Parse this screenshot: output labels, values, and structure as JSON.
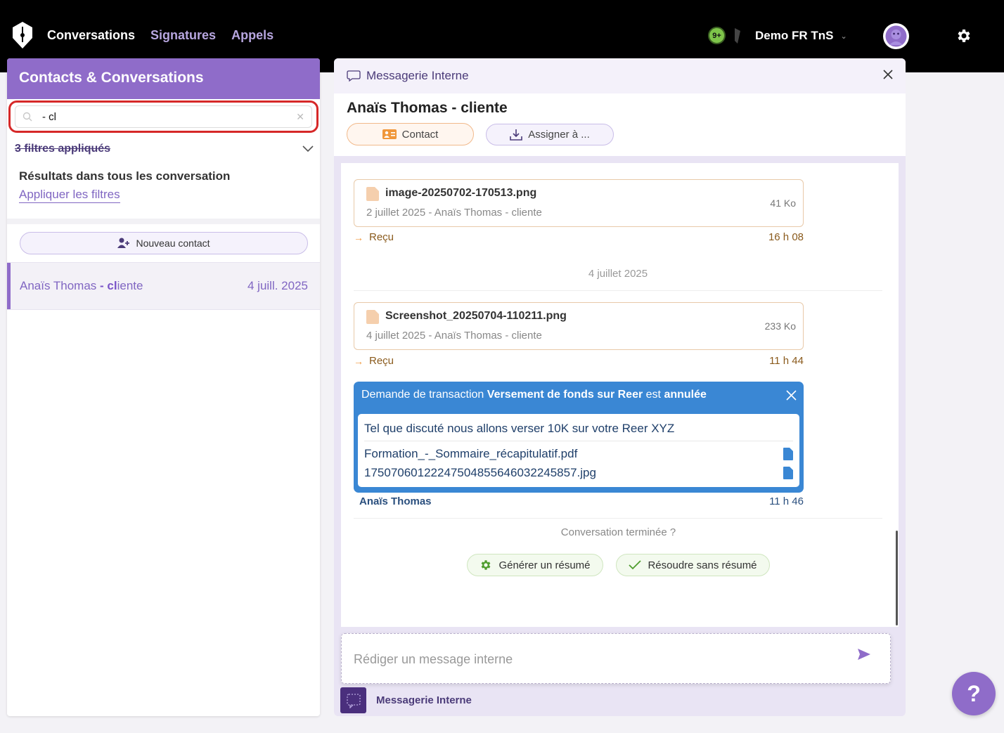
{
  "nav": {
    "items": [
      {
        "label": "Conversations",
        "active": true
      },
      {
        "label": "Signatures",
        "active": false
      },
      {
        "label": "Appels",
        "active": false
      }
    ],
    "notif_count": "9+",
    "account_name": "Demo FR TnS",
    "colors": {
      "bar": "#000000",
      "active": "#ffffff",
      "inactive": "#b7a6df",
      "notif": "#7ec44a"
    }
  },
  "left": {
    "title": "Contacts & Conversations",
    "search_value": "- cl",
    "filters_label": "3 filtres appliqués",
    "results_title": "Résultats dans tous les conversation",
    "apply_filters": "Appliquer les filtres",
    "new_contact": "Nouveau contact",
    "conversations": [
      {
        "name_prefix": "Anaïs Thomas ",
        "name_match": "- cl",
        "name_suffix": "iente",
        "date": "4 juill. 2025"
      }
    ]
  },
  "main": {
    "top_title": "Messagerie Interne",
    "contact_name": "Anaïs Thomas - cliente",
    "contact_button": "Contact",
    "assign_button": "Assigner à ...",
    "files": [
      {
        "name": "image-20250702-170513.png",
        "meta": "2 juillet 2025 - Anaïs Thomas - cliente",
        "size": "41 Ko",
        "status": "Reçu",
        "time": "16 h 08"
      },
      {
        "name": "Screenshot_20250704-110211.png",
        "meta": "4 juillet 2025 - Anaïs Thomas - cliente",
        "size": "233 Ko",
        "status": "Reçu",
        "time": "11 h 44"
      }
    ],
    "date_separator": "4 juillet 2025",
    "transaction": {
      "prefix": "Demande de transaction ",
      "name": "Versement de fonds sur Reer",
      "middle": " est ",
      "state": "annulée",
      "message": "Tel que discuté nous allons verser 10K sur votre Reer XYZ",
      "attachments": [
        "Formation_-_Sommaire_récapitulatif.pdf",
        "1750706012224750485564603224585​7.jpg"
      ],
      "author": "Anaïs Thomas",
      "time": "11 h 46"
    },
    "ended_question": "Conversation terminée ?",
    "generate_summary": "Générer un résumé",
    "resolve_no_summary": "Résoudre sans résumé",
    "composer_placeholder": "Rédiger un message interne",
    "footer_label": "Messagerie Interne",
    "colors": {
      "accent": "#8f6cc9",
      "transaction": "#3a87d4",
      "file_border": "#e8c9a9",
      "pill_green": "#f3faee"
    }
  },
  "help_label": "?"
}
